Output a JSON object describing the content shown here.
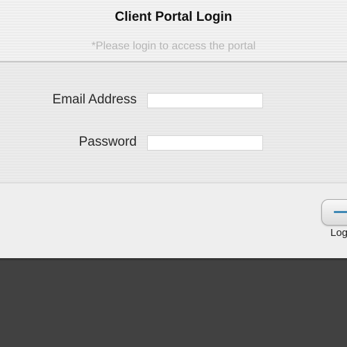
{
  "header": {
    "title": "Client Portal Login",
    "subtitle": "*Please login to access the portal"
  },
  "form": {
    "email": {
      "label": "Email Address",
      "value": "",
      "placeholder": ""
    },
    "password": {
      "label": "Password",
      "value": "",
      "placeholder": ""
    }
  },
  "footer": {
    "login_label": "Log",
    "login_icon": "login-icon"
  },
  "colors": {
    "page_background": "#414141",
    "panel_background": "#ededed",
    "subtitle_text": "#b5b5b5",
    "login_icon_accent": "#3f88b5"
  }
}
